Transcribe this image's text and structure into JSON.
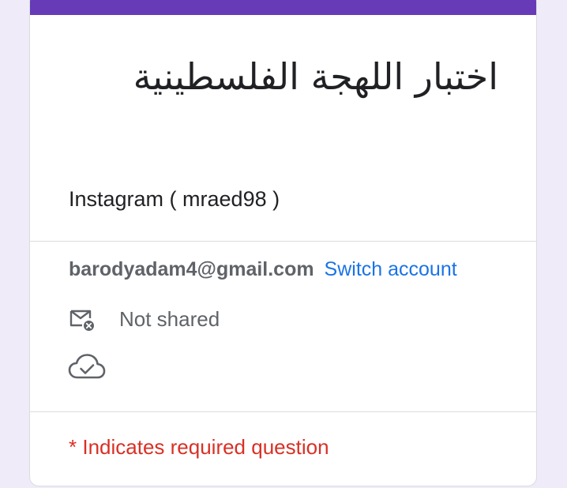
{
  "form": {
    "title": "اختبار اللهجة الفلسطينية",
    "description": "Instagram ( mraed98 )"
  },
  "account": {
    "email": "barodyadam4@gmail.com",
    "switch_label": "Switch account",
    "email_status": "Not shared",
    "icons": [
      "mail-not-shared-icon",
      "cloud-saved-icon"
    ]
  },
  "required_note": "* Indicates required question",
  "colors": {
    "accent": "#673ab7",
    "link": "#1a73e8",
    "required": "#d93025",
    "page_background": "#f0ebf8"
  }
}
